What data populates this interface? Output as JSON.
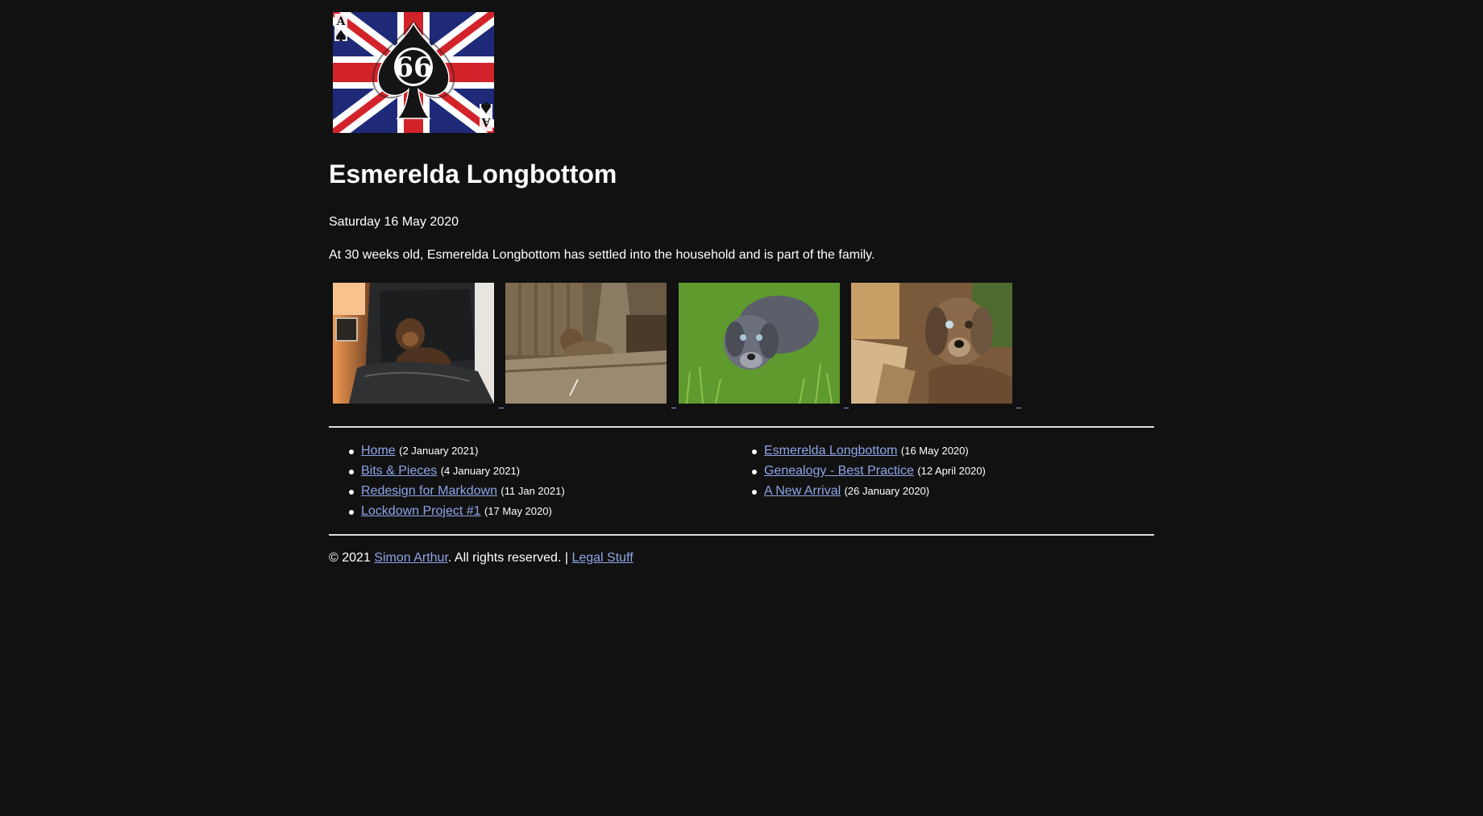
{
  "header": {
    "logo_text": "66",
    "logo_corner": "A"
  },
  "article": {
    "title": "Esmerelda Longbottom",
    "date": "Saturday 16 May 2020",
    "intro": "At 30 weeks old, Esmerelda Longbottom has settled into the household and is part of the family."
  },
  "gallery": [
    {
      "subject": "dog-on-leather-chair"
    },
    {
      "subject": "dog-on-wooden-sleeper"
    },
    {
      "subject": "dog-lying-in-grass"
    },
    {
      "subject": "dog-close-up-in-sun"
    }
  ],
  "nav": {
    "left": [
      {
        "label": "Home",
        "when": "(2 January 2021)"
      },
      {
        "label": "Bits & Pieces",
        "when": "(4 January 2021)"
      },
      {
        "label": "Redesign for Markdown",
        "when": "(11 Jan 2021)"
      },
      {
        "label": "Lockdown Project #1",
        "when": "(17 May 2020)"
      }
    ],
    "right": [
      {
        "label": "Esmerelda Longbottom",
        "when": "(16 May 2020)"
      },
      {
        "label": "Genealogy - Best Practice",
        "when": "(12 April 2020)"
      },
      {
        "label": "A New Arrival",
        "when": "(26 January 2020)"
      }
    ]
  },
  "footer": {
    "prefix": "© 2021 ",
    "author": "Simon Arthur",
    "middle": ". All rights reserved. | ",
    "legal": "Legal Stuff"
  },
  "colors": {
    "background": "#111111",
    "text": "#ffffff",
    "link": "#8fa4e8",
    "rule": "#dddddd"
  }
}
